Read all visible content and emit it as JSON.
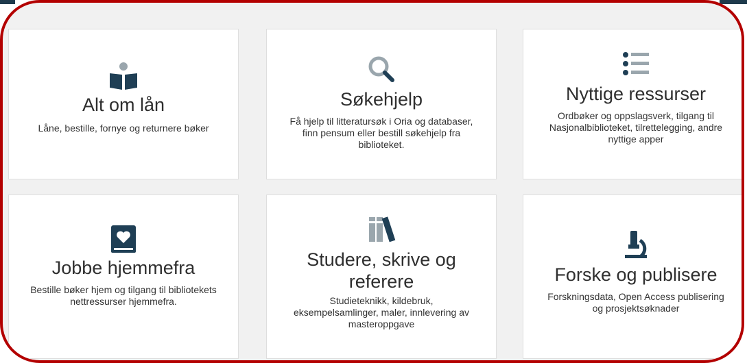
{
  "colors": {
    "frame": "#b30000",
    "icon": "#1f3f55",
    "icon_accent": "#9aa6ad",
    "card_bg": "#ffffff",
    "page_bg": "#f1f1f1"
  },
  "cards": [
    {
      "icon": "book-reader-icon",
      "title": "Alt om lån",
      "description": "Låne, bestille, fornye og returnere bøker"
    },
    {
      "icon": "search-icon",
      "title": "Søkehjelp",
      "description": "Få hjelp til litteratursøk i Oria og databaser, finn pensum eller bestill søkehjelp fra biblioteket."
    },
    {
      "icon": "list-icon",
      "title": "Nyttige ressurser",
      "description": "Ordbøker og oppslagsverk, tilgang til Nasjonalbiblioteket, tilrettelegging, andre nyttige apper"
    },
    {
      "icon": "book-heart-icon",
      "title": "Jobbe hjemmefra",
      "description": "Bestille bøker hjem og tilgang til bibliotekets nettressurser hjemmefra."
    },
    {
      "icon": "books-icon",
      "title": "Studere, skrive og referere",
      "description": "Studieteknikk, kildebruk, eksempelsamlinger, maler, innlevering av masteroppgave"
    },
    {
      "icon": "microscope-icon",
      "title": "Forske og publisere",
      "description": "Forskningsdata, Open Access publisering og prosjektsøknader"
    }
  ]
}
